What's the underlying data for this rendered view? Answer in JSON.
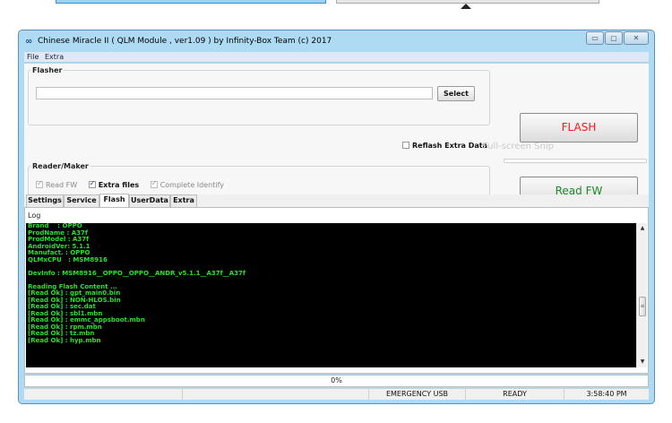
{
  "window": {
    "title": "Chinese Miracle II ( QLM Module , ver1.09  ) by Infinity-Box Team (c) 2017",
    "icon": "infinity-icon",
    "controls": [
      "minimize-icon",
      "maximize-icon",
      "close-icon"
    ]
  },
  "menu": {
    "file": "File",
    "extra": "Extra"
  },
  "flasher": {
    "title": "Flasher",
    "path_value": "",
    "select_label": "Select",
    "reflash_label": "Reflash Extra Data",
    "reflash_checked": false
  },
  "overlay": {
    "text": "Full-screen Snip"
  },
  "reader": {
    "title": "Reader/Maker",
    "read_fw": {
      "label": "Read FW",
      "checked": true,
      "disabled": true
    },
    "extra_files": {
      "label": "Extra files",
      "checked": true,
      "disabled": false
    },
    "complete_identify": {
      "label": "Complete Identify",
      "checked": true,
      "disabled": true
    }
  },
  "buttons": {
    "flash": "FLASH",
    "read_fw": "Read FW"
  },
  "colors": {
    "flash_text": "#ee1c1c",
    "readfw_text": "#1d8a2a",
    "log_text": "#27e12a",
    "window_frame": "#aedbf3"
  },
  "tabs": [
    {
      "label": "Settings",
      "active": false
    },
    {
      "label": "Service",
      "active": false
    },
    {
      "label": "Flash",
      "active": true
    },
    {
      "label": "UserData",
      "active": false
    },
    {
      "label": "Extra",
      "active": false
    }
  ],
  "log": {
    "label": "Log",
    "lines": [
      "Brand    : OPPO",
      "ProdName : A37f",
      "ProdModel : A37f",
      "AndroidVer: 5.1.1",
      "Manufact. : OPPO",
      "QLMxCPU   : MSM8916",
      "",
      "DevInfo : MSM8916__OPPO__OPPO__ANDR_v5.1.1__A37f__A37f",
      "",
      "Reading Flash Content ...",
      "[Read Ok] : gpt_main0.bin",
      "[Read Ok] : NON-HLOS.bin",
      "[Read Ok] : sec.dat",
      "[Read Ok] : sbl1.mbn",
      "[Read Ok] : emmc_appsboot.mbn",
      "[Read Ok] : rpm.mbn",
      "[Read Ok] : tz.mbn",
      "[Read Ok] : hyp.mbn"
    ]
  },
  "progress": {
    "text": "0%",
    "value": 0
  },
  "status": {
    "mode": "EMERGENCY USB",
    "state": "READY",
    "time": "3:58:40 PM"
  }
}
